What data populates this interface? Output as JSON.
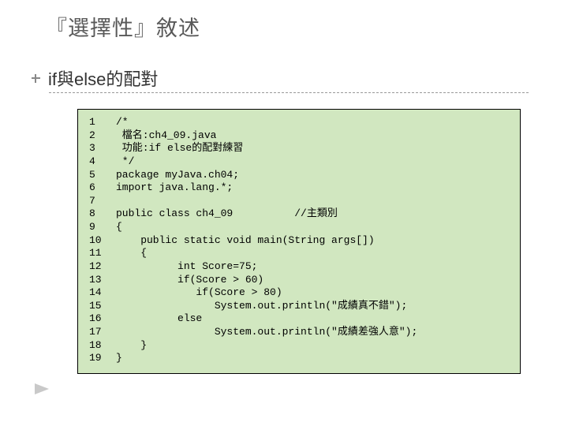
{
  "title": "『選擇性』敘述",
  "subtitle": "if與else的配對",
  "code": {
    "lines": [
      {
        "n": "1",
        "t": "/*"
      },
      {
        "n": "2",
        "t": " 檔名:ch4_09.java"
      },
      {
        "n": "3",
        "t": " 功能:if else的配對練習"
      },
      {
        "n": "4",
        "t": " */"
      },
      {
        "n": "5",
        "t": "package myJava.ch04;"
      },
      {
        "n": "6",
        "t": "import java.lang.*;"
      },
      {
        "n": "7",
        "t": ""
      },
      {
        "n": "8",
        "t": "public class ch4_09          //主類別"
      },
      {
        "n": "9",
        "t": "{"
      },
      {
        "n": "10",
        "t": "    public static void main(String args[])"
      },
      {
        "n": "11",
        "t": "    {"
      },
      {
        "n": "12",
        "t": "          int Score=75;"
      },
      {
        "n": "13",
        "t": "          if(Score > 60)"
      },
      {
        "n": "14",
        "t": "             if(Score > 80)"
      },
      {
        "n": "15",
        "t": "                System.out.println(\"成績真不錯\");"
      },
      {
        "n": "16",
        "t": "          else"
      },
      {
        "n": "17",
        "t": "                System.out.println(\"成績差強人意\");"
      },
      {
        "n": "18",
        "t": "    }"
      },
      {
        "n": "19",
        "t": "}"
      }
    ]
  }
}
